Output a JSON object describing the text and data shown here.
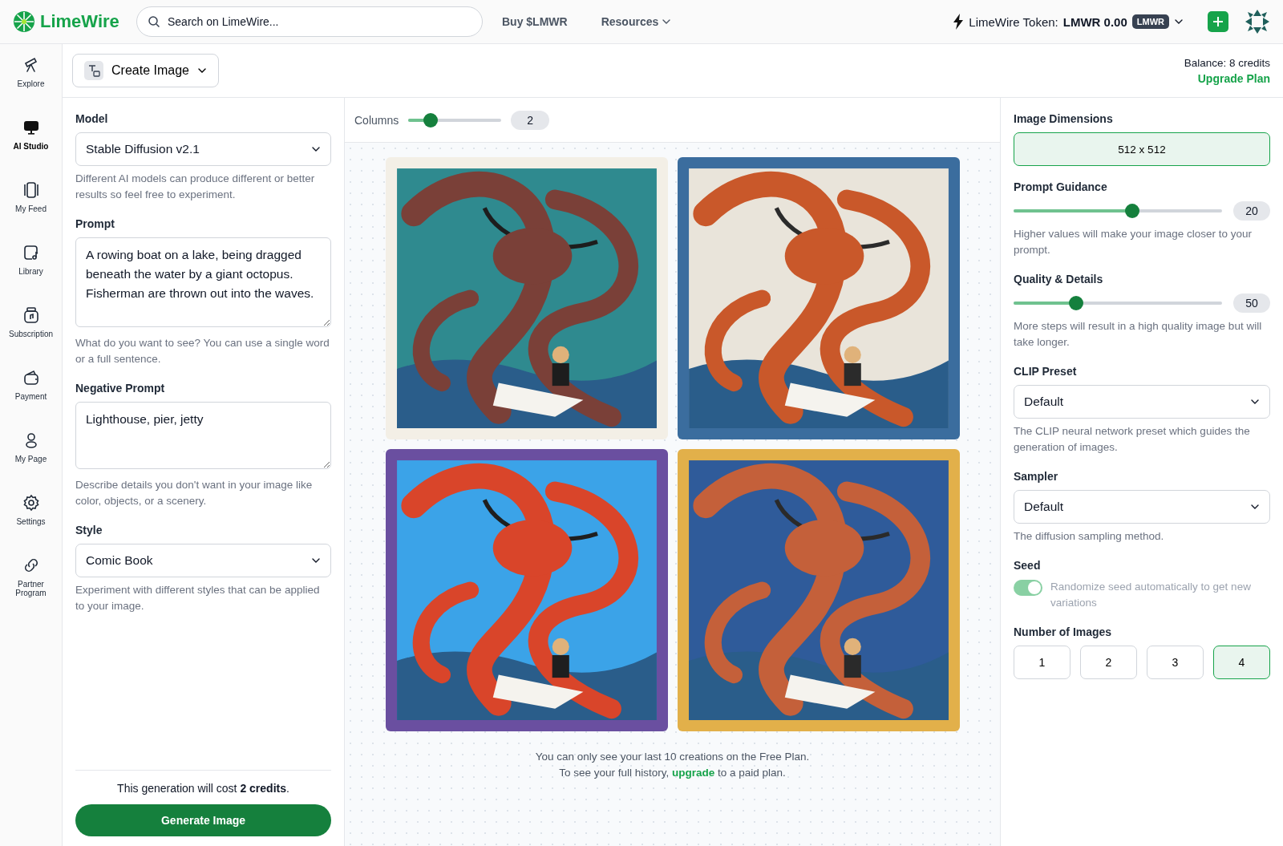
{
  "topbar": {
    "brand": "LimeWire",
    "search": {
      "placeholder": "Search on LimeWire..."
    },
    "nav": [
      {
        "label": "Buy $LMWR",
        "has_menu": false
      },
      {
        "label": "Resources",
        "has_menu": true
      }
    ],
    "token": {
      "label": "LimeWire Token:",
      "amount": "LMWR 0.00",
      "badge": "LMWR"
    }
  },
  "sidebar": {
    "items": [
      {
        "label": "Explore",
        "selected": false
      },
      {
        "label": "AI Studio",
        "selected": true
      },
      {
        "label": "My Feed",
        "selected": false
      },
      {
        "label": "Library",
        "selected": false
      },
      {
        "label": "Subscription",
        "selected": false
      },
      {
        "label": "Payment",
        "selected": false
      },
      {
        "label": "My Page",
        "selected": false
      },
      {
        "label": "Settings",
        "selected": false
      },
      {
        "label": "Partner Program",
        "selected": false
      }
    ]
  },
  "header": {
    "mode": "Create Image",
    "balance": "Balance: 8 credits",
    "upgrade": "Upgrade Plan"
  },
  "left_panel": {
    "fields": [
      {
        "kind": "select",
        "label": "Model",
        "value": "Stable Diffusion v2.1",
        "hint": "Different AI models can produce different or better results so feel free to experiment."
      },
      {
        "kind": "textarea",
        "label": "Prompt",
        "value": "A rowing boat on a lake, being dragged beneath the water by a giant octopus. Fisherman are thrown out into the waves.",
        "hint": "What do you want to see? You can use a single word or a full sentence."
      },
      {
        "kind": "textarea",
        "label": "Negative Prompt",
        "value": "Lighthouse, pier, jetty",
        "hint": "Describe details you don't want in your image like color, objects, or a scenery."
      },
      {
        "kind": "select",
        "label": "Style",
        "value": "Comic Book",
        "hint": "Experiment with different styles that can be applied to your image."
      }
    ],
    "cost": "This generation will cost **2 credits**.",
    "button": "Generate Image"
  },
  "center": {
    "columns": {
      "label": "Columns",
      "level": 0.24,
      "value": "2"
    },
    "note": {
      "line1": "You can only see your last 10 creations on the Free Plan.",
      "before": "To see your full history,",
      "link": "upgrade",
      "after": "to a paid plan."
    }
  },
  "right_panel": {
    "sections": [
      {
        "kind": "button",
        "label": "Image Dimensions",
        "value": "512 x 512"
      },
      {
        "kind": "slider",
        "label": "Prompt Guidance",
        "level": 0.57,
        "value": "20",
        "hint": "Higher values will make your image closer to your prompt."
      },
      {
        "kind": "slider",
        "label": "Quality & Details",
        "level": 0.3,
        "value": "50",
        "hint": "More steps will result in a high quality image but will take longer."
      },
      {
        "kind": "select",
        "label": "CLIP Preset",
        "value": "Default",
        "hint": "The CLIP neural network preset which guides the generation of images."
      },
      {
        "kind": "select",
        "label": "Sampler",
        "value": "Default",
        "hint": "The diffusion sampling method."
      },
      {
        "kind": "toggle",
        "label": "Seed",
        "on": true,
        "disabled": true,
        "text": "Randomize seed automatically to get new variations"
      },
      {
        "kind": "options",
        "label": "Number of Images",
        "options": [
          {
            "label": "1",
            "selected": false
          },
          {
            "label": "2",
            "selected": false
          },
          {
            "label": "3",
            "selected": false
          },
          {
            "label": "4",
            "selected": true
          }
        ]
      }
    ]
  }
}
